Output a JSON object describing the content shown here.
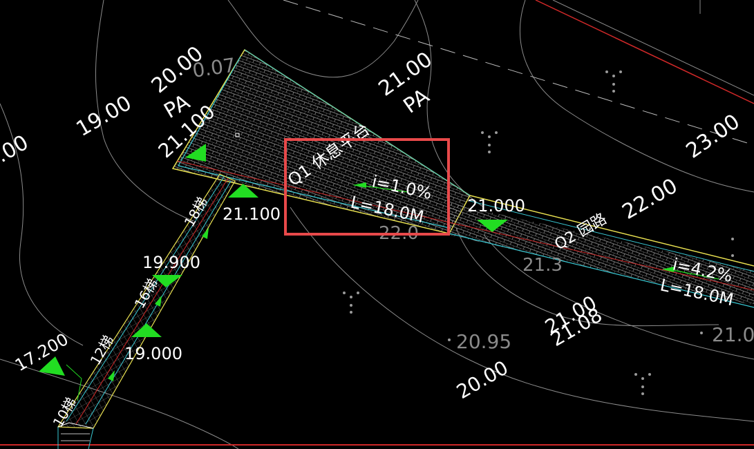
{
  "colors": {
    "background": "#000000",
    "text": "#ffffff",
    "grey_text": "#8a8a8a",
    "contour": "#8c8c8c",
    "path_edge_yellow": "#e8e050",
    "path_edge_cyan": "#39c9d4",
    "centerline_red": "#d02828",
    "arrow_green": "#22dd22",
    "highlight_box": "#e8494a"
  },
  "labels": {
    "contour_20_00_top": "20.00",
    "contour_19_00": "19.00",
    "contour_21_00_top": "21.00",
    "contour_23_00": "23.00",
    "contour_22_00": "22.00",
    "contour_left_00": ".00",
    "pa_left": "PA",
    "pa_right": "PA",
    "partial_0_07": "0.07",
    "platform_elev_21_100": "21.100",
    "platform_name": "Q1 休息平台",
    "platform_slope": "i=1.0%",
    "platform_length": "L=18.0M",
    "elev_21_000": "21.000",
    "garden_road": "Q2 园路",
    "road_slope": "i=4.2%",
    "road_length": "L=18.0M",
    "elev_21_100_stairs": "21.100",
    "stairs_18": "18梯",
    "elev_19_900": "19.900",
    "stairs_16": "16梯",
    "elev_19_000": "19.000",
    "stairs_12": "12梯",
    "elev_17_200": "17.200",
    "stairs_10": "10梯",
    "spot_20_95": "20.95",
    "contour_20_00_bottom": "20.00",
    "contour_21_00_diag": "21.00",
    "contour_21_08": "21.08",
    "partial_21_0": "21.0",
    "partial_21_3": "21.3",
    "partial_22": "22.0"
  }
}
